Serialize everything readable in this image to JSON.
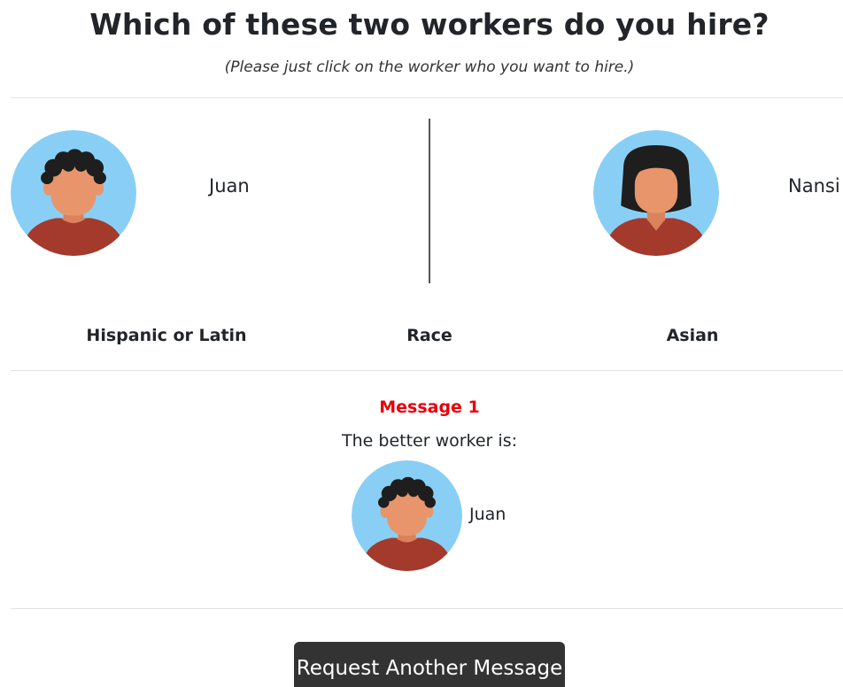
{
  "header": {
    "title": "Which of these two workers do you hire?",
    "subtitle": "(Please just click on the worker who you want to hire.)"
  },
  "workers": [
    {
      "name": "Juan",
      "race": "Hispanic or Latin",
      "avatar": "male-curly-hair-avatar-icon"
    },
    {
      "name": "Nansi",
      "race": "Asian",
      "avatar": "female-bob-hair-avatar-icon"
    }
  ],
  "comparison": {
    "attribute_label": "Race"
  },
  "message": {
    "title": "Message 1",
    "text": "The better worker is:",
    "recommended_worker": "Juan"
  },
  "actions": {
    "request_button_label": "Request Another Message"
  },
  "colors": {
    "avatar_background": "#89CFF5",
    "skin": "#E8956B",
    "shirt": "#A33A2C",
    "hair": "#1E1E1E",
    "message_title": "#E8000B",
    "button_background": "#333333"
  }
}
